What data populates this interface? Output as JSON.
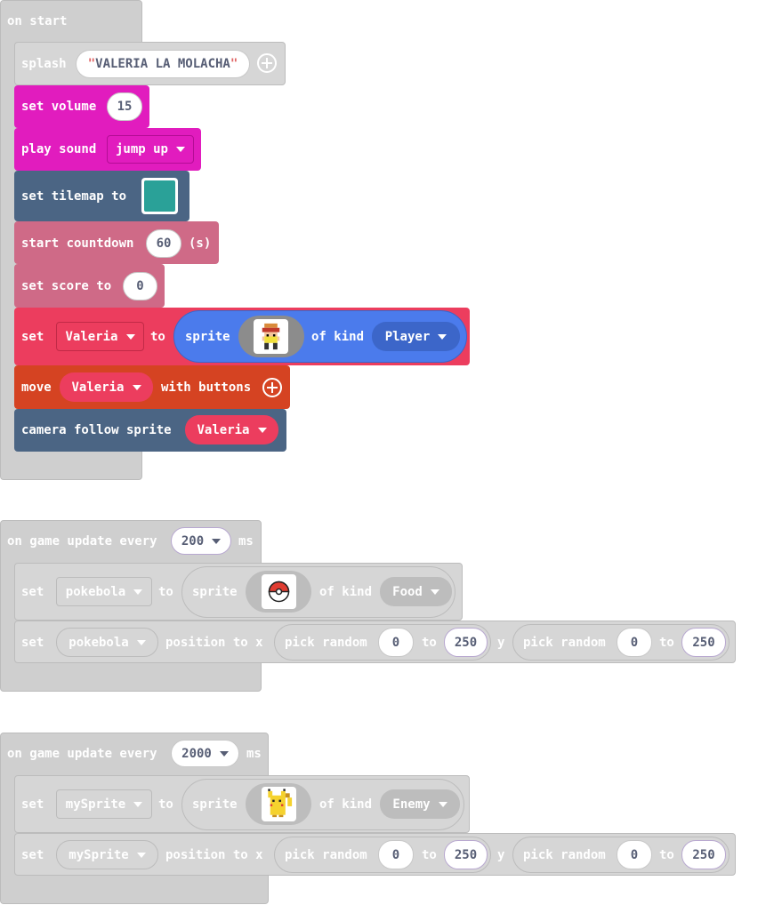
{
  "on_start": {
    "hat_label": "on start",
    "splash": {
      "label": "splash",
      "value": "VALERIA LA MOLACHA",
      "quote": "\""
    },
    "set_volume": {
      "label": "set volume",
      "value": "15"
    },
    "play_sound": {
      "label": "play sound",
      "value": "jump up"
    },
    "set_tilemap": {
      "label": "set tilemap to",
      "color": "#2aa198"
    },
    "start_countdown": {
      "label": "start countdown",
      "value": "60",
      "unit": "(s)"
    },
    "set_score": {
      "label": "set score to",
      "value": "0"
    },
    "set_sprite": {
      "set": "set",
      "variable": "Valeria",
      "to": "to",
      "sprite": "sprite",
      "of_kind": "of kind",
      "kind": "Player"
    },
    "move": {
      "label": "move",
      "variable": "Valeria",
      "with": "with buttons"
    },
    "camera": {
      "label": "camera follow sprite",
      "variable": "Valeria"
    }
  },
  "update1": {
    "hat_label": "on game update every",
    "interval": "200",
    "unit": "ms",
    "set_sprite": {
      "set": "set",
      "variable": "pokebola",
      "to": "to",
      "sprite": "sprite",
      "of_kind": "of kind",
      "kind": "Food"
    },
    "set_position": {
      "set": "set",
      "variable": "pokebola",
      "position": "position to x",
      "pick_random": "pick random",
      "x_from": "0",
      "to": "to",
      "x_to": "250",
      "y": "y",
      "y_from": "0",
      "y_to": "250"
    }
  },
  "update2": {
    "hat_label": "on game update every",
    "interval": "2000",
    "unit": "ms",
    "set_sprite": {
      "set": "set",
      "variable": "mySprite",
      "to": "to",
      "sprite": "sprite",
      "of_kind": "of kind",
      "kind": "Enemy"
    },
    "set_position": {
      "set": "set",
      "variable": "mySprite",
      "position": "position to x",
      "pick_random": "pick random",
      "x_from": "0",
      "to": "to",
      "x_to": "250",
      "y": "y",
      "y_from": "0",
      "y_to": "250"
    }
  },
  "colors": {
    "disabled": "#cfcfcf",
    "music": "#e11cbe",
    "scene": "#4b6584",
    "info": "#cf6a87",
    "sprites": "#4b7bec",
    "set_var": "#ec3d5e",
    "controller": "#d54322"
  },
  "icons": [
    "plus-icon",
    "dropdown-caret-icon",
    "player-sprite-icon",
    "pokeball-icon",
    "pikachu-icon"
  ]
}
